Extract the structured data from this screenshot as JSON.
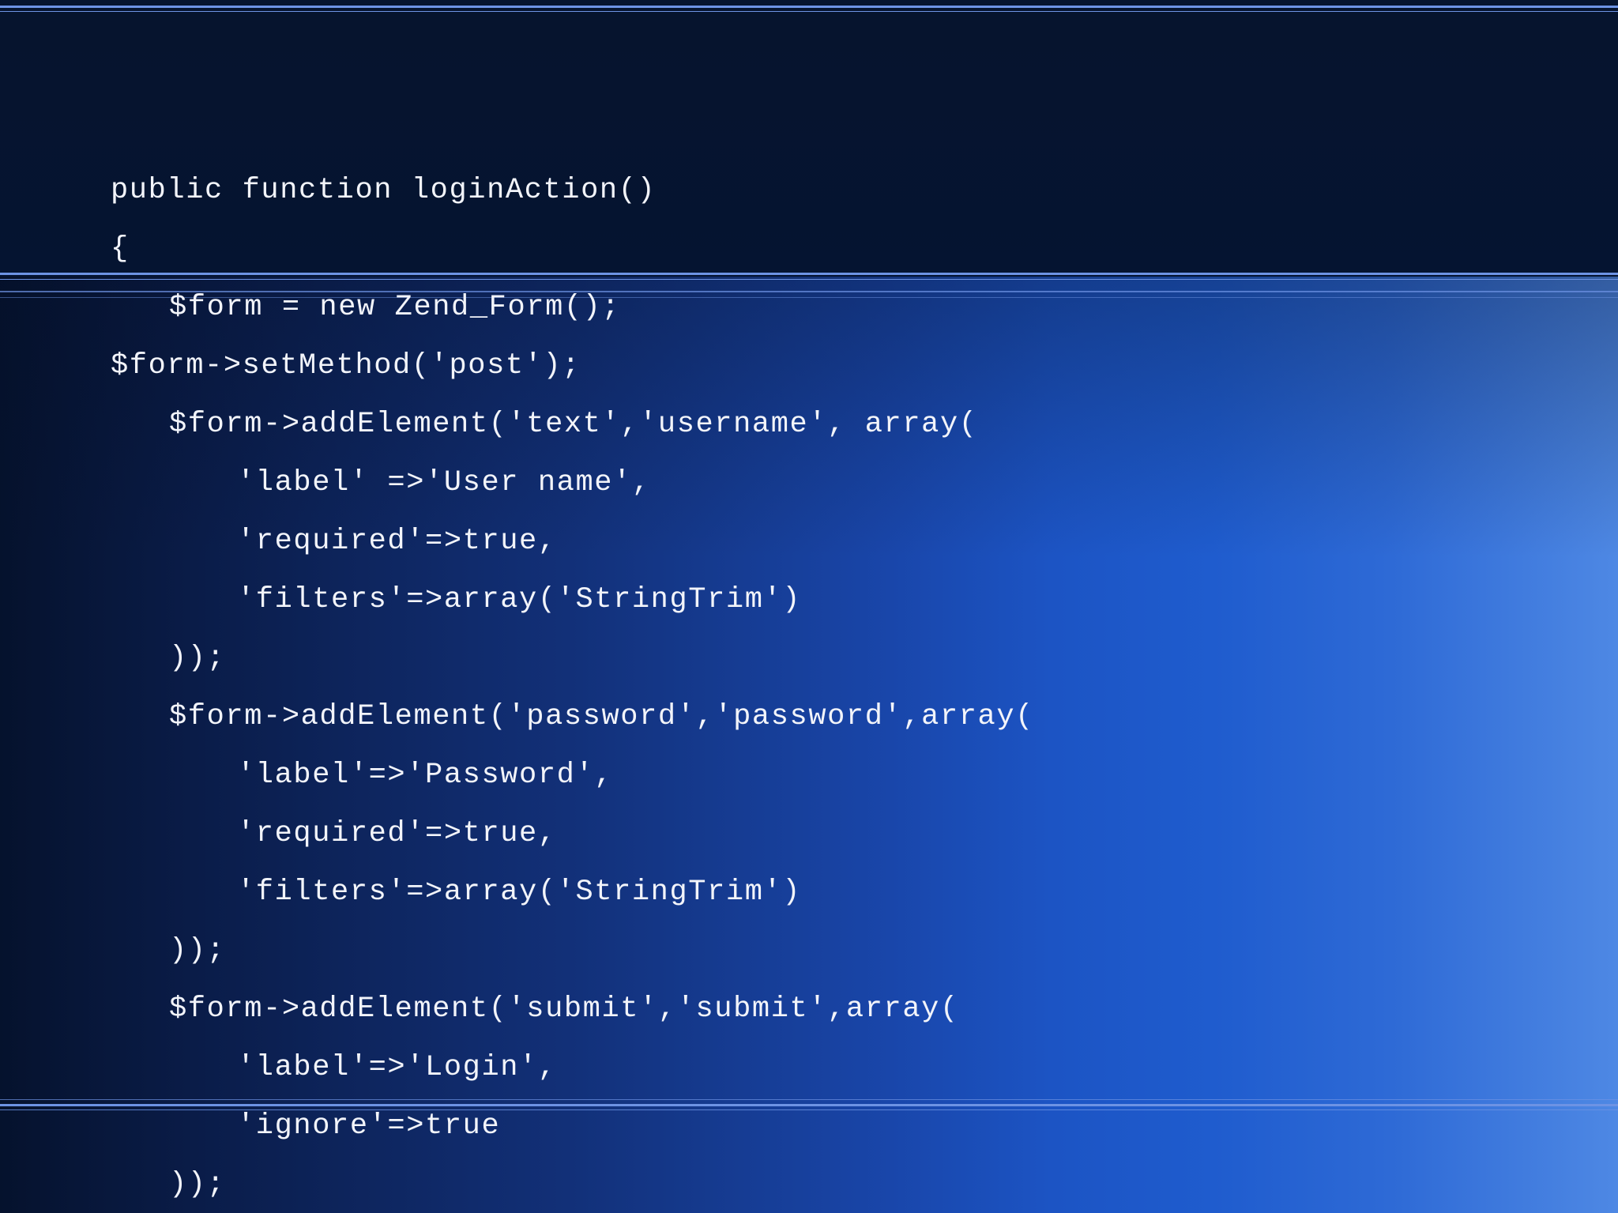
{
  "code": {
    "lines": [
      "public function loginAction()",
      "{",
      "$form = new Zend_Form();",
      "$form->setMethod('post');",
      "$form->addElement('text','username', array(",
      "'label' =>'User name',",
      "'required'=>true,",
      "'filters'=>array('StringTrim')",
      "));",
      "$form->addElement('password','password',array(",
      "'label'=>'Password',",
      "'required'=>true,",
      "'filters'=>array('StringTrim')",
      "));",
      "$form->addElement('submit','submit',array(",
      "'label'=>'Login',",
      "'ignore'=>true",
      "));"
    ]
  }
}
